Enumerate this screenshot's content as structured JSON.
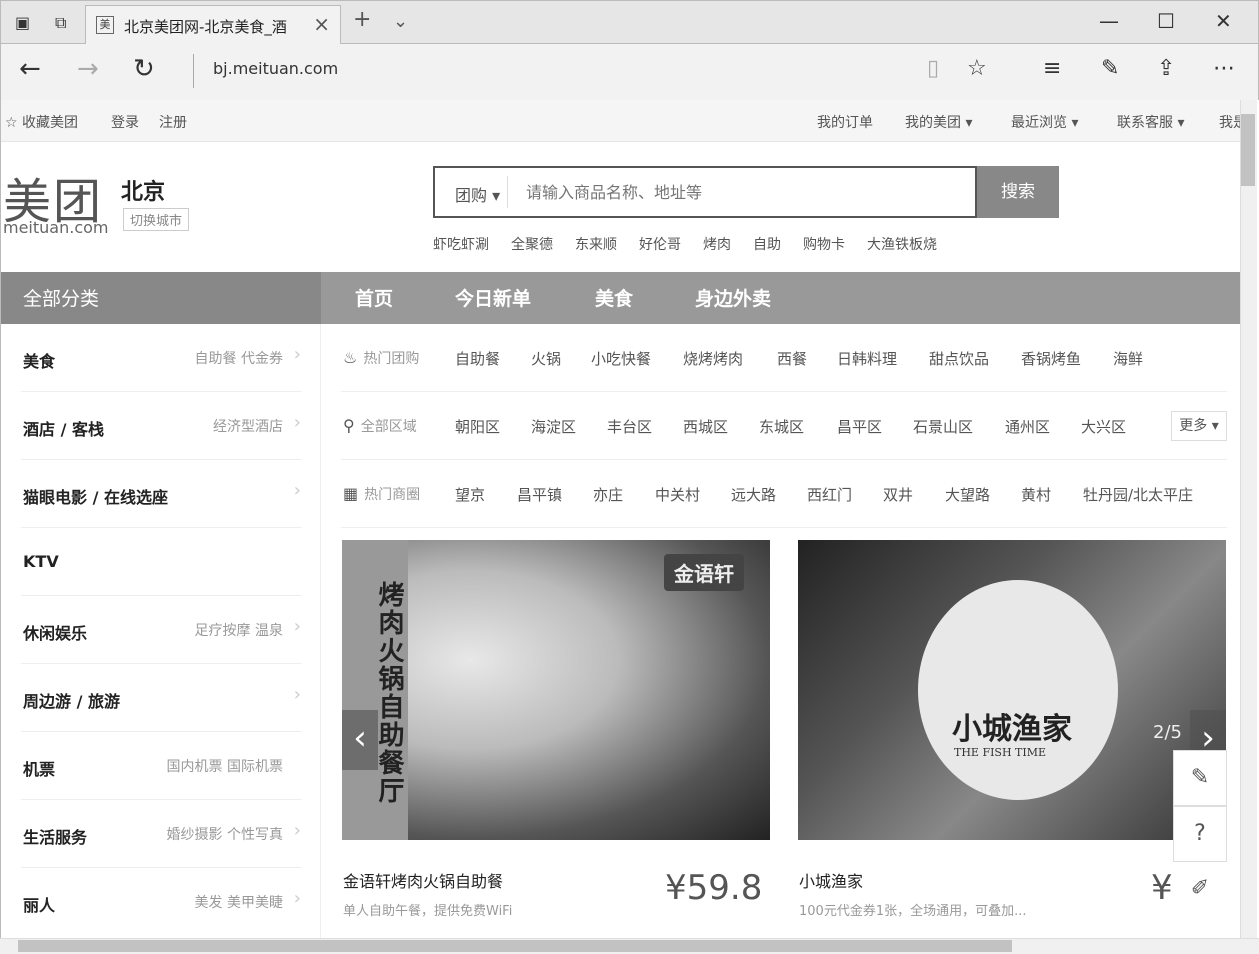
{
  "browser": {
    "tab_title": "北京美团网-北京美食_酒",
    "tab_favicon": "美",
    "url": "bj.meituan.com"
  },
  "topnav": {
    "left": [
      "☆ 收藏美团",
      "登录",
      "注册"
    ],
    "right": [
      "我的订单",
      "我的美团 ▾",
      "最近浏览 ▾",
      "联系客服 ▾",
      "我是"
    ]
  },
  "header": {
    "logo": "美团",
    "logo_sub": "meituan.com",
    "city": "北京",
    "switch_city": "切换城市",
    "search_type": "团购 ▾",
    "search_placeholder": "请输入商品名称、地址等",
    "search_button": "搜索",
    "hot_words": [
      "虾吃虾涮",
      "全聚德",
      "东来顺",
      "好伦哥",
      "烤肉",
      "自助",
      "购物卡",
      "大渔铁板烧"
    ]
  },
  "nav": {
    "all_categories": "全部分类",
    "items": [
      "首页",
      "今日新单",
      "美食",
      "身边外卖"
    ]
  },
  "sidebar": [
    {
      "name": "美食",
      "sub": "自助餐 代金券"
    },
    {
      "name": "酒店 / 客栈",
      "sub": "经济型酒店"
    },
    {
      "name": "猫眼电影 / 在线选座",
      "sub": ""
    },
    {
      "name": "KTV",
      "sub": ""
    },
    {
      "name": "休闲娱乐",
      "sub": "足疗按摩 温泉"
    },
    {
      "name": "周边游 / 旅游",
      "sub": ""
    },
    {
      "name": "机票",
      "sub": "国内机票 国际机票"
    },
    {
      "name": "生活服务",
      "sub": "婚纱摄影 个性写真"
    },
    {
      "name": "丽人",
      "sub": "美发 美甲美睫"
    }
  ],
  "filters": {
    "hot_deals": {
      "label": "热门团购",
      "items": [
        "自助餐",
        "火锅",
        "小吃快餐",
        "烧烤烤肉",
        "西餐",
        "日韩料理",
        "甜点饮品",
        "香锅烤鱼",
        "海鲜"
      ]
    },
    "regions": {
      "label": "全部区域",
      "items": [
        "朝阳区",
        "海淀区",
        "丰台区",
        "西城区",
        "东城区",
        "昌平区",
        "石景山区",
        "通州区",
        "大兴区"
      ],
      "more": "更多 ▾"
    },
    "districts": {
      "label": "热门商圈",
      "items": [
        "望京",
        "昌平镇",
        "亦庄",
        "中关村",
        "远大路",
        "西红门",
        "双井",
        "大望路",
        "黄村",
        "牡丹园/北太平庄"
      ]
    }
  },
  "deals": [
    {
      "title": "金语轩烤肉火锅自助餐",
      "desc": "单人自助午餐，提供免费WiFi",
      "price": "¥59.8",
      "img_band": "烤肉火锅自助餐厅",
      "img_badge": "金语轩"
    },
    {
      "title": "小城渔家",
      "desc": "100元代金券1张，全场通用，可叠加...",
      "price": "¥",
      "img_logo": "小城渔家",
      "img_logo_sub": "THE FISH TIME"
    }
  ],
  "carousel_counter": "2/5"
}
